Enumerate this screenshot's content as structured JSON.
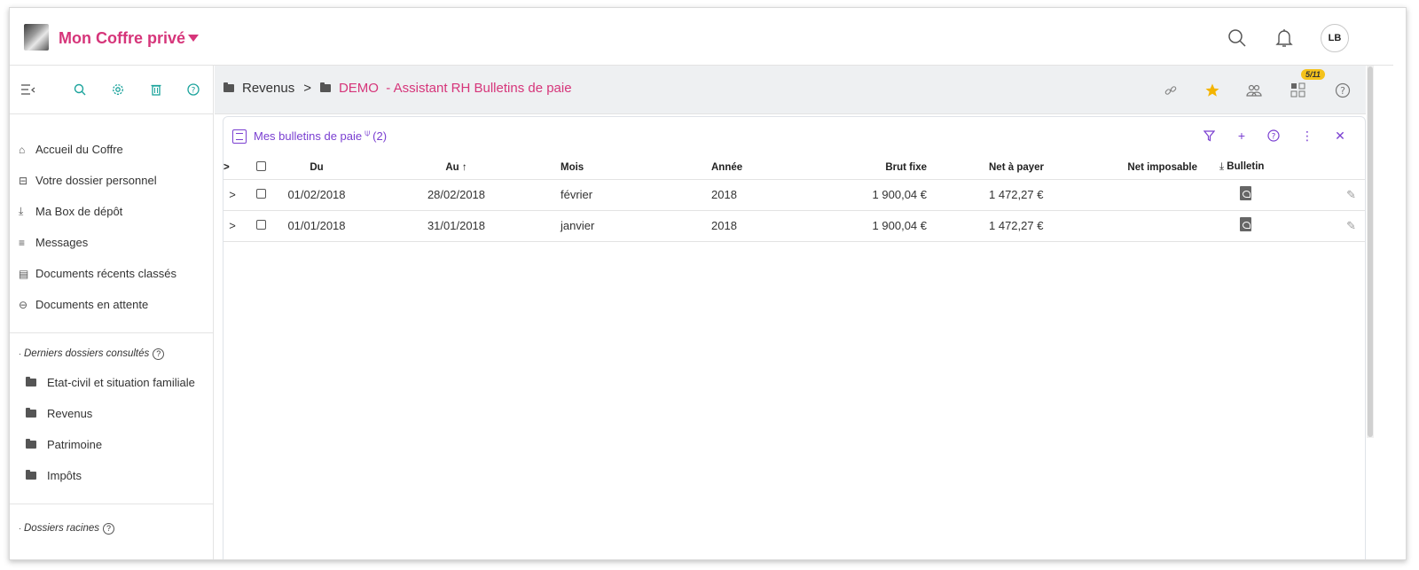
{
  "app": {
    "title": "Mon Coffre privé",
    "user_initials": "LB"
  },
  "sidebar": {
    "nav_items": [
      {
        "icon": "home-icon",
        "label": "Accueil du Coffre"
      },
      {
        "icon": "folder-personal-icon",
        "label": "Votre dossier personnel"
      },
      {
        "icon": "download-icon",
        "label": "Ma Box de dépôt"
      },
      {
        "icon": "message-icon",
        "label": "Messages"
      },
      {
        "icon": "document-icon",
        "label": "Documents récents classés"
      },
      {
        "icon": "inbox-icon",
        "label": "Documents en attente"
      }
    ],
    "recent_title": "Derniers dossiers consultés",
    "recent_folders": [
      "Etat-civil et situation familiale",
      "Revenus",
      "Patrimoine",
      "Impôts"
    ],
    "root_title": "Dossiers racines"
  },
  "breadcrumb": {
    "parent": "Revenus",
    "current": "DEMO  - Assistant RH Bulletins de paie",
    "count_badge": "5/11"
  },
  "panel": {
    "title": "Mes bulletins de paie",
    "count": "(2)",
    "columns": {
      "du": "Du",
      "au": "Au",
      "mois": "Mois",
      "annee": "Année",
      "brut_fixe": "Brut fixe",
      "net_a_payer": "Net à payer",
      "net_imposable": "Net imposable",
      "bulletin": "Bulletin"
    },
    "rows": [
      {
        "du": "01/02/2018",
        "au": "28/02/2018",
        "mois": "février",
        "annee": "2018",
        "brut_fixe": "1 900,04 €",
        "net_a_payer": "1 472,27 €",
        "net_imposable": ""
      },
      {
        "du": "01/01/2018",
        "au": "31/01/2018",
        "mois": "janvier",
        "annee": "2018",
        "brut_fixe": "1 900,04 €",
        "net_a_payer": "1 472,27 €",
        "net_imposable": ""
      }
    ]
  },
  "colors": {
    "brand": "#d6357a",
    "accent_teal": "#1ba39c",
    "accent_purple": "#7a3fd1",
    "star": "#f4b400",
    "badge": "#f4c21b"
  }
}
